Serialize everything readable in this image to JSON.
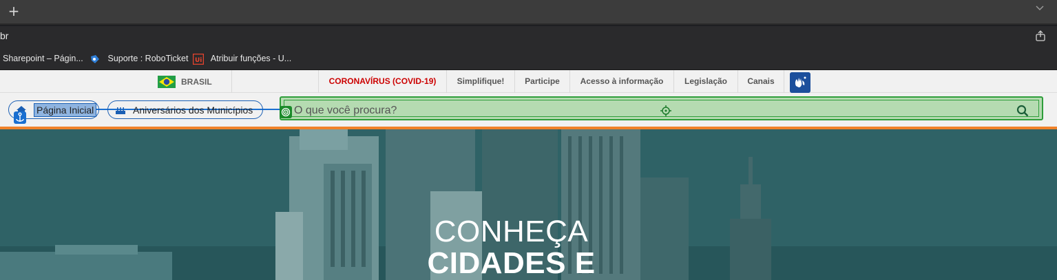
{
  "browser": {
    "new_tab_icon": "plus-icon",
    "tab_menu_icon": "chevron-down-icon",
    "url_fragment": "br",
    "share_icon": "share-icon",
    "bookmarks": [
      {
        "label": "Sharepoint – Págin...",
        "icon": "none"
      },
      {
        "label": "Suporte : RoboTicket",
        "icon": "roboticket-icon"
      },
      {
        "label": "Atribuir funções - U...",
        "icon": "uipath-icon"
      }
    ]
  },
  "govbar": {
    "country": "BRASIL",
    "links": [
      {
        "label": "CORONAVÍRUS (COVID-19)",
        "color": "#cc0000"
      },
      {
        "label": "Simplifique!"
      },
      {
        "label": "Participe"
      },
      {
        "label": "Acesso à informação"
      },
      {
        "label": "Legislação"
      },
      {
        "label": "Canais"
      }
    ],
    "accessibility_icon": "vlibras-hands-icon"
  },
  "nav": {
    "home_label": "Página Inicial",
    "anniversary_label": "Aniversários dos Municípios"
  },
  "search": {
    "placeholder": "O que você procura?"
  },
  "hero": {
    "line1": "CONHEÇA",
    "line2": "CIDADES E"
  },
  "colors": {
    "accent_orange": "#f0822a",
    "search_highlight": "#b5dbb1",
    "link_blue": "#1a5fb4"
  }
}
